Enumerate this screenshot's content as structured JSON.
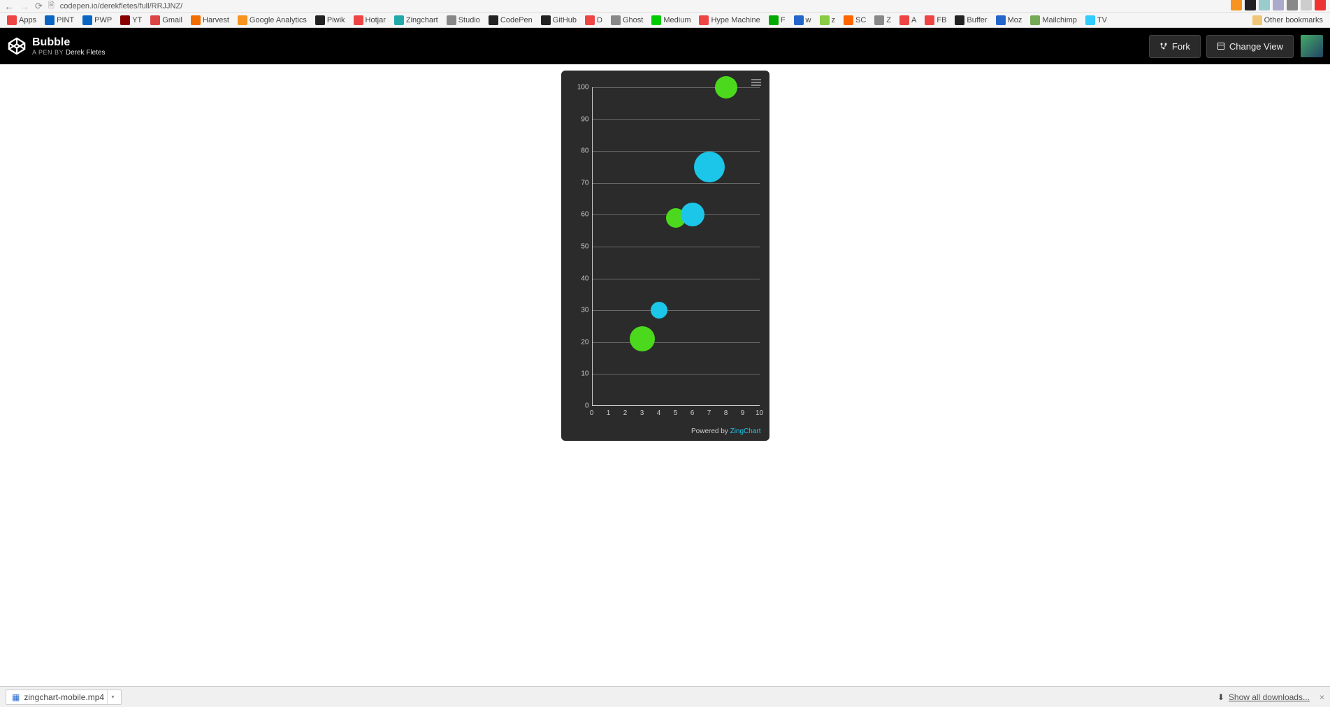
{
  "browser": {
    "url": "codepen.io/derekfletes/full/RRJJNZ/",
    "ext_colors": [
      "#f7931e",
      "#222",
      "#9cc",
      "#aac",
      "#888",
      "#ccc",
      "#e33"
    ]
  },
  "bookmarks": [
    {
      "label": "Apps",
      "color": "#e44"
    },
    {
      "label": "PINT",
      "color": "#0a66c2"
    },
    {
      "label": "PWP",
      "color": "#0a66c2"
    },
    {
      "label": "YT",
      "color": "#800"
    },
    {
      "label": "Gmail",
      "color": "#d44"
    },
    {
      "label": "Harvest",
      "color": "#f36c00"
    },
    {
      "label": "Google Analytics",
      "color": "#f7931e"
    },
    {
      "label": "Piwik",
      "color": "#222"
    },
    {
      "label": "Hotjar",
      "color": "#e44"
    },
    {
      "label": "Zingchart",
      "color": "#2aa"
    },
    {
      "label": "Studio",
      "color": "#888"
    },
    {
      "label": "CodePen",
      "color": "#222"
    },
    {
      "label": "GitHub",
      "color": "#222"
    },
    {
      "label": "D",
      "color": "#e44"
    },
    {
      "label": "Ghost",
      "color": "#888"
    },
    {
      "label": "Medium",
      "color": "#0c0"
    },
    {
      "label": "Hype Machine",
      "color": "#e44"
    },
    {
      "label": "F",
      "color": "#0a0"
    },
    {
      "label": "w",
      "color": "#26c"
    },
    {
      "label": "z",
      "color": "#8c4"
    },
    {
      "label": "SC",
      "color": "#f60"
    },
    {
      "label": "Z",
      "color": "#888"
    },
    {
      "label": "A",
      "color": "#e44"
    },
    {
      "label": "FB",
      "color": "#e44"
    },
    {
      "label": "Buffer",
      "color": "#222"
    },
    {
      "label": "Moz",
      "color": "#26c"
    },
    {
      "label": "Mailchimp",
      "color": "#7a5"
    },
    {
      "label": "TV",
      "color": "#3cf"
    }
  ],
  "other_bookmarks": "Other bookmarks",
  "codepen": {
    "title": "Bubble",
    "byline_prefix": "A PEN BY ",
    "author": "Derek Fletes",
    "fork": "Fork",
    "change_view": "Change View"
  },
  "chart_data": {
    "type": "bubble",
    "x_ticks": [
      0,
      1,
      2,
      3,
      4,
      5,
      6,
      7,
      8,
      9,
      10
    ],
    "y_ticks": [
      0,
      10,
      20,
      30,
      40,
      50,
      60,
      70,
      80,
      90,
      100
    ],
    "xlim": [
      0,
      10
    ],
    "ylim": [
      0,
      100
    ],
    "series": [
      {
        "name": "green",
        "color": "#4cd91d",
        "points": [
          {
            "x": 3,
            "y": 21,
            "size": 18
          },
          {
            "x": 5,
            "y": 59,
            "size": 14
          },
          {
            "x": 8,
            "y": 100,
            "size": 16
          }
        ]
      },
      {
        "name": "cyan",
        "color": "#1bc6e8",
        "points": [
          {
            "x": 4,
            "y": 30,
            "size": 12
          },
          {
            "x": 6,
            "y": 60,
            "size": 17
          },
          {
            "x": 7,
            "y": 75,
            "size": 22
          }
        ]
      }
    ],
    "powered_by_prefix": "Powered by ",
    "powered_by_link": "ZingChart"
  },
  "downloads": {
    "item": "zingchart-mobile.mp4",
    "show_all": "Show all downloads...",
    "close": "×"
  }
}
